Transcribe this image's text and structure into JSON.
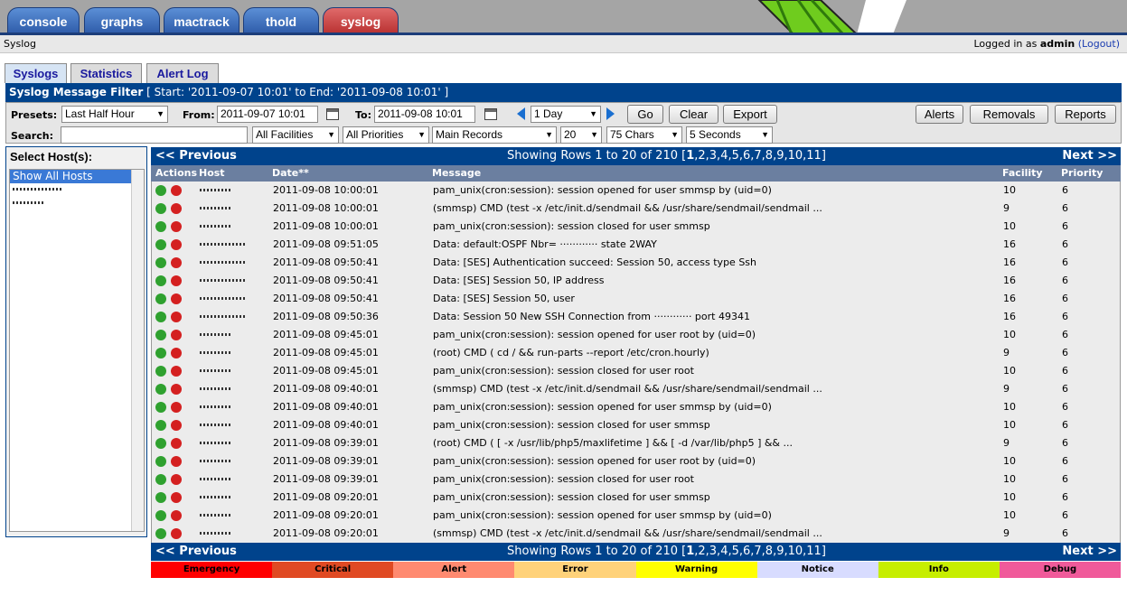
{
  "top_tabs": [
    "console",
    "graphs",
    "mactrack",
    "thold",
    "syslog"
  ],
  "breadcrumb": {
    "left": "Syslog",
    "logged_prefix": "Logged in as",
    "user": "admin",
    "logout": "(Logout)"
  },
  "tabs": [
    "Syslogs",
    "Statistics",
    "Alert Log"
  ],
  "filter": {
    "title": "Syslog Message Filter",
    "range": "[ Start: '2011-09-07 10:01' to End: '2011-09-08 10:01' ]",
    "presets_label": "Presets:",
    "presets_value": "Last Half Hour",
    "from_label": "From:",
    "from_value": "2011-09-07 10:01",
    "to_label": "To:",
    "to_value": "2011-09-08 10:01",
    "span_value": "1 Day",
    "go": "Go",
    "clear": "Clear",
    "export": "Export",
    "alerts": "Alerts",
    "removals": "Removals",
    "reports": "Reports",
    "search_label": "Search:",
    "search_value": "",
    "facilities": "All Facilities",
    "priorities": "All Priorities",
    "records": "Main Records",
    "rows": "20",
    "chars": "75 Chars",
    "refresh": "5 Seconds"
  },
  "hosts": {
    "title": "Select Host(s):",
    "items": [
      "Show All Hosts"
    ]
  },
  "nav": {
    "prev": "<< Previous",
    "showing": "Showing Rows 1 to 20 of 210 [",
    "current": "1",
    ",pages": "",
    "pages": ",2,3,4,5,6,7,8,9,10,11]",
    "next": "Next >>"
  },
  "columns": {
    "actions": "Actions",
    "host": "Host",
    "date": "Date**",
    "message": "Message",
    "facility": "Facility",
    "priority": "Priority"
  },
  "rows": [
    {
      "date": "2011-09-08 10:00:01",
      "message": "pam_unix(cron:session): session opened for user smmsp by (uid=0)",
      "facility": "10",
      "priority": "6"
    },
    {
      "date": "2011-09-08 10:00:01",
      "message": "(smmsp) CMD (test -x /etc/init.d/sendmail && /usr/share/sendmail/sendmail ...",
      "facility": "9",
      "priority": "6"
    },
    {
      "date": "2011-09-08 10:00:01",
      "message": "pam_unix(cron:session): session closed for user smmsp",
      "facility": "10",
      "priority": "6"
    },
    {
      "date": "2011-09-08 09:51:05",
      "message": "Data: default:OSPF Nbr=",
      "message_tail": " state 2WAY",
      "facility": "16",
      "priority": "6"
    },
    {
      "date": "2011-09-08 09:50:41",
      "message": "Data: [SES] Authentication succeed: Session 50, access type Ssh",
      "facility": "16",
      "priority": "6"
    },
    {
      "date": "2011-09-08 09:50:41",
      "message": "Data: [SES] Session 50, IP address",
      "facility": "16",
      "priority": "6"
    },
    {
      "date": "2011-09-08 09:50:41",
      "message": "Data: [SES] Session 50, user",
      "facility": "16",
      "priority": "6"
    },
    {
      "date": "2011-09-08 09:50:36",
      "message": "Data: Session 50 New SSH Connection from",
      "message_tail": " port 49341",
      "facility": "16",
      "priority": "6"
    },
    {
      "date": "2011-09-08 09:45:01",
      "message": "pam_unix(cron:session): session opened for user root by (uid=0)",
      "facility": "10",
      "priority": "6"
    },
    {
      "date": "2011-09-08 09:45:01",
      "message": "(root) CMD ( cd / && run-parts --report /etc/cron.hourly)",
      "facility": "9",
      "priority": "6"
    },
    {
      "date": "2011-09-08 09:45:01",
      "message": "pam_unix(cron:session): session closed for user root",
      "facility": "10",
      "priority": "6"
    },
    {
      "date": "2011-09-08 09:40:01",
      "message": "(smmsp) CMD (test -x /etc/init.d/sendmail && /usr/share/sendmail/sendmail ...",
      "facility": "9",
      "priority": "6"
    },
    {
      "date": "2011-09-08 09:40:01",
      "message": "pam_unix(cron:session): session opened for user smmsp by (uid=0)",
      "facility": "10",
      "priority": "6"
    },
    {
      "date": "2011-09-08 09:40:01",
      "message": "pam_unix(cron:session): session closed for user smmsp",
      "facility": "10",
      "priority": "6"
    },
    {
      "date": "2011-09-08 09:39:01",
      "message": "(root) CMD ( [ -x /usr/lib/php5/maxlifetime ] && [ -d /var/lib/php5 ] && ...",
      "facility": "9",
      "priority": "6"
    },
    {
      "date": "2011-09-08 09:39:01",
      "message": "pam_unix(cron:session): session opened for user root by (uid=0)",
      "facility": "10",
      "priority": "6"
    },
    {
      "date": "2011-09-08 09:39:01",
      "message": "pam_unix(cron:session): session closed for user root",
      "facility": "10",
      "priority": "6"
    },
    {
      "date": "2011-09-08 09:20:01",
      "message": "pam_unix(cron:session): session closed for user smmsp",
      "facility": "10",
      "priority": "6"
    },
    {
      "date": "2011-09-08 09:20:01",
      "message": "pam_unix(cron:session): session opened for user smmsp by (uid=0)",
      "facility": "10",
      "priority": "6"
    },
    {
      "date": "2011-09-08 09:20:01",
      "message": "(smmsp) CMD (test -x /etc/init.d/sendmail && /usr/share/sendmail/sendmail ...",
      "facility": "9",
      "priority": "6"
    }
  ],
  "legend": [
    {
      "label": "Emergency",
      "color": "#ff0000"
    },
    {
      "label": "Critical",
      "color": "#e04a23"
    },
    {
      "label": "Alert",
      "color": "#ff8a70"
    },
    {
      "label": "Error",
      "color": "#ffd27a"
    },
    {
      "label": "Warning",
      "color": "#ffff00"
    },
    {
      "label": "Notice",
      "color": "#d8dcff"
    },
    {
      "label": "Info",
      "color": "#c6ee00"
    },
    {
      "label": "Debug",
      "color": "#f05a9a"
    }
  ]
}
